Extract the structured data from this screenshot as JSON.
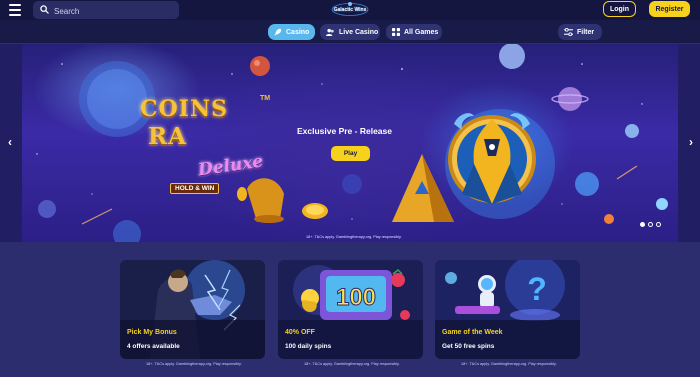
{
  "header": {
    "search_placeholder": "Search",
    "logo_text": "Galactic Wins",
    "login_label": "Login",
    "register_label": "Register"
  },
  "category_nav": {
    "tabs": [
      {
        "label": "Casino",
        "icon": "rocket-icon",
        "active": true
      },
      {
        "label": "Live Casino",
        "icon": "live-dealer-icon",
        "active": false
      },
      {
        "label": "All Games",
        "icon": "grid-icon",
        "active": false
      }
    ],
    "filter_label": "Filter"
  },
  "hero": {
    "game_logo_line1": "COINS",
    "game_logo_line2": "RA",
    "game_logo_line3": "Deluxe",
    "game_logo_badge": "HOLD & WIN",
    "game_logo_tm": "TM",
    "headline": "Exclusive Pre - Release",
    "play_label": "Play",
    "disclaimer": "18+. T&Cs apply. Gamblingtherapy.org. Play responsibly.",
    "slide_count": 3,
    "active_slide": 1
  },
  "promos": [
    {
      "title": "Pick My Bonus",
      "subtitle": "4 offers available",
      "disclaimer": "18+. T&Cs apply. Gamblingtherapy.org. Play responsibly."
    },
    {
      "title": "40% OFF",
      "subtitle": "100 daily spins",
      "disclaimer": "18+. T&Cs apply. Gamblingtherapy.org. Play responsibly.",
      "art_text": "100"
    },
    {
      "title": "Game of the Week",
      "subtitle": "Get 50 free spins",
      "disclaimer": "18+. T&Cs apply. Gamblingtherapy.org. Play responsibly."
    }
  ],
  "colors": {
    "accent_yellow": "#f7d21c",
    "active_tab": "#5ab7ee",
    "page_bg": "#2b2d6e",
    "header_bg": "#14163f"
  }
}
